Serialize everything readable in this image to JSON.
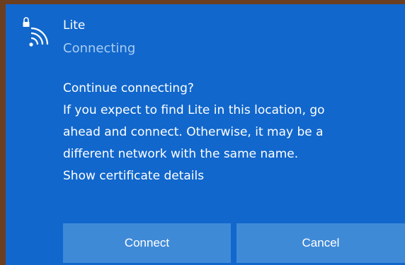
{
  "network": {
    "name": "Lite",
    "status": "Connecting",
    "icon": "wifi-secured-icon"
  },
  "message": {
    "heading": "Continue connecting?",
    "body_lines": [
      "If you expect to find Lite in this location, go",
      "ahead and connect. Otherwise, it may be a",
      "different network with the same name."
    ],
    "link": "Show certificate details"
  },
  "buttons": {
    "connect_label": "Connect",
    "cancel_label": "Cancel"
  },
  "colors": {
    "panel": "#1167cc",
    "button": "#3f8ad7",
    "status_text": "#a9cdf2",
    "frame": "#6b3e1f"
  }
}
